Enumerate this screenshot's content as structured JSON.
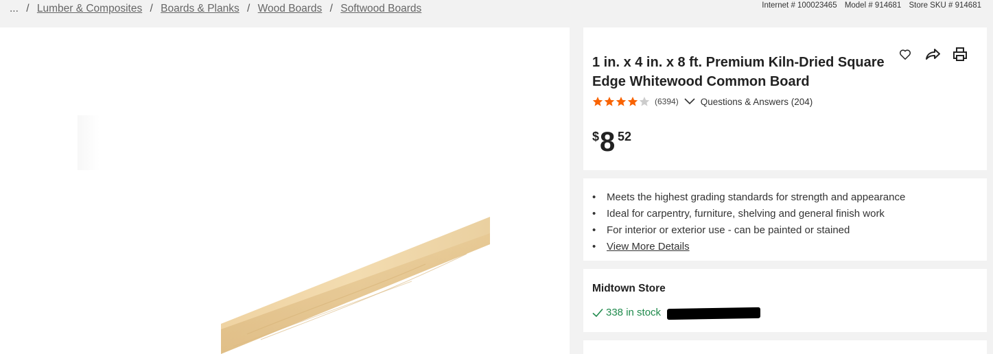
{
  "breadcrumb": {
    "ellipsis": "...",
    "items": [
      "Lumber & Composites",
      "Boards & Planks",
      "Wood Boards",
      "Softwood Boards"
    ]
  },
  "identifiers": {
    "internet": "Internet # 100023465",
    "model": "Model # 914681",
    "store_sku": "Store SKU # 914681"
  },
  "product": {
    "title": "1 in. x 4 in. x 8 ft. Premium Kiln-Dried Square Edge Whitewood Common Board",
    "rating_stars": 4,
    "rating_max": 5,
    "review_count": "(6394)",
    "qa_label": "Questions & Answers (204)",
    "price": {
      "currency": "$",
      "dollars": "8",
      "cents": "52"
    }
  },
  "actions": {
    "icons": [
      "heart-icon",
      "share-icon",
      "print-icon"
    ]
  },
  "highlights": {
    "bullets": [
      "Meets the highest grading standards for strength and appearance",
      "Ideal for carpentry, furniture, shelving and general finish work",
      "For interior or exterior use - can be painted or stained"
    ],
    "more_link": "View More Details"
  },
  "store": {
    "name": "Midtown Store",
    "stock_text": "338 in stock"
  },
  "colors": {
    "star": "#f96302",
    "star_empty": "#cccccc",
    "stock_green": "#1f8a4c",
    "card_bg": "#ffffff",
    "page_bg": "#f2f2f2"
  }
}
